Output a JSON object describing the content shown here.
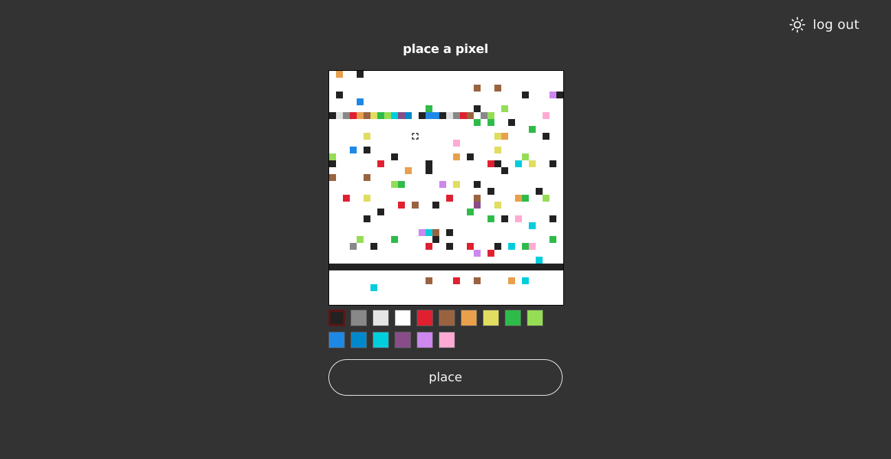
{
  "header": {
    "theme_toggle_icon": "sun-icon",
    "logout_label": "log out"
  },
  "title": "place a pixel",
  "canvas": {
    "background": "#ffffff",
    "grid_cells": 34,
    "cursor_cell": [
      12,
      9
    ],
    "pixels": [
      [
        1,
        0,
        "#e8a04c"
      ],
      [
        4,
        0,
        "#222222"
      ],
      [
        21,
        2,
        "#9a6340"
      ],
      [
        24,
        2,
        "#9a6340"
      ],
      [
        1,
        3,
        "#222222"
      ],
      [
        28,
        3,
        "#222222"
      ],
      [
        32,
        3,
        "#cc88ee"
      ],
      [
        33,
        3,
        "#222222"
      ],
      [
        4,
        4,
        "#1e88e5"
      ],
      [
        14,
        5,
        "#2ebb4a"
      ],
      [
        21,
        5,
        "#222222"
      ],
      [
        25,
        5,
        "#95dd55"
      ],
      [
        0,
        6,
        "#222222"
      ],
      [
        1,
        6,
        "#e0e0e0"
      ],
      [
        2,
        6,
        "#888888"
      ],
      [
        3,
        6,
        "#e02030"
      ],
      [
        4,
        6,
        "#e8a04c"
      ],
      [
        5,
        6,
        "#9a6340"
      ],
      [
        6,
        6,
        "#e0dd60"
      ],
      [
        7,
        6,
        "#2ebb4a"
      ],
      [
        8,
        6,
        "#95dd55"
      ],
      [
        9,
        6,
        "#00cedd"
      ],
      [
        10,
        6,
        "#884d88"
      ],
      [
        11,
        6,
        "#0088cc"
      ],
      [
        13,
        6,
        "#222222"
      ],
      [
        14,
        6,
        "#1e88e5"
      ],
      [
        15,
        6,
        "#1e88e5"
      ],
      [
        16,
        6,
        "#222222"
      ],
      [
        17,
        6,
        "#e0e0e0"
      ],
      [
        18,
        6,
        "#888888"
      ],
      [
        19,
        6,
        "#e02030"
      ],
      [
        20,
        6,
        "#9a6340"
      ],
      [
        22,
        6,
        "#888888"
      ],
      [
        23,
        6,
        "#95dd55"
      ],
      [
        31,
        6,
        "#ffaad4"
      ],
      [
        21,
        7,
        "#2ebb4a"
      ],
      [
        23,
        7,
        "#2ebb4a"
      ],
      [
        26,
        7,
        "#222222"
      ],
      [
        29,
        8,
        "#2ebb4a"
      ],
      [
        5,
        9,
        "#e0dd60"
      ],
      [
        24,
        9,
        "#e0dd60"
      ],
      [
        25,
        9,
        "#e8a04c"
      ],
      [
        31,
        9,
        "#222222"
      ],
      [
        18,
        10,
        "#ffaad4"
      ],
      [
        3,
        11,
        "#1e88e5"
      ],
      [
        5,
        11,
        "#222222"
      ],
      [
        24,
        11,
        "#e0dd60"
      ],
      [
        0,
        12,
        "#95dd55"
      ],
      [
        9,
        12,
        "#222222"
      ],
      [
        18,
        12,
        "#e8a04c"
      ],
      [
        20,
        12,
        "#222222"
      ],
      [
        28,
        12,
        "#95dd55"
      ],
      [
        0,
        13,
        "#222222"
      ],
      [
        7,
        13,
        "#e02030"
      ],
      [
        14,
        13,
        "#222222"
      ],
      [
        23,
        13,
        "#e02030"
      ],
      [
        24,
        13,
        "#222222"
      ],
      [
        27,
        13,
        "#00cedd"
      ],
      [
        29,
        13,
        "#e0dd60"
      ],
      [
        32,
        13,
        "#222222"
      ],
      [
        11,
        14,
        "#e8a04c"
      ],
      [
        14,
        14,
        "#222222"
      ],
      [
        25,
        14,
        "#222222"
      ],
      [
        0,
        15,
        "#9a6340"
      ],
      [
        5,
        15,
        "#9a6340"
      ],
      [
        9,
        16,
        "#95dd55"
      ],
      [
        10,
        16,
        "#2ebb4a"
      ],
      [
        16,
        16,
        "#cc88ee"
      ],
      [
        18,
        16,
        "#e0dd60"
      ],
      [
        21,
        16,
        "#222222"
      ],
      [
        23,
        17,
        "#222222"
      ],
      [
        30,
        17,
        "#222222"
      ],
      [
        2,
        18,
        "#e02030"
      ],
      [
        5,
        18,
        "#e0dd60"
      ],
      [
        17,
        18,
        "#e02030"
      ],
      [
        21,
        18,
        "#9a6340"
      ],
      [
        27,
        18,
        "#e8a04c"
      ],
      [
        28,
        18,
        "#2ebb4a"
      ],
      [
        31,
        18,
        "#95dd55"
      ],
      [
        10,
        19,
        "#e02030"
      ],
      [
        12,
        19,
        "#9a6340"
      ],
      [
        15,
        19,
        "#222222"
      ],
      [
        21,
        19,
        "#884d88"
      ],
      [
        24,
        19,
        "#e0dd60"
      ],
      [
        7,
        20,
        "#222222"
      ],
      [
        20,
        20,
        "#2ebb4a"
      ],
      [
        5,
        21,
        "#222222"
      ],
      [
        23,
        21,
        "#2ebb4a"
      ],
      [
        25,
        21,
        "#222222"
      ],
      [
        27,
        21,
        "#ffaad4"
      ],
      [
        32,
        21,
        "#222222"
      ],
      [
        29,
        22,
        "#00cedd"
      ],
      [
        13,
        23,
        "#cc88ee"
      ],
      [
        14,
        23,
        "#00cedd"
      ],
      [
        15,
        23,
        "#9a6340"
      ],
      [
        17,
        23,
        "#222222"
      ],
      [
        4,
        24,
        "#95dd55"
      ],
      [
        9,
        24,
        "#2ebb4a"
      ],
      [
        15,
        24,
        "#222222"
      ],
      [
        32,
        24,
        "#2ebb4a"
      ],
      [
        3,
        25,
        "#888888"
      ],
      [
        6,
        25,
        "#222222"
      ],
      [
        14,
        25,
        "#e02030"
      ],
      [
        17,
        25,
        "#222222"
      ],
      [
        20,
        25,
        "#e02030"
      ],
      [
        24,
        25,
        "#222222"
      ],
      [
        26,
        25,
        "#00cedd"
      ],
      [
        28,
        25,
        "#2ebb4a"
      ],
      [
        29,
        25,
        "#ffaad4"
      ],
      [
        21,
        26,
        "#cc88ee"
      ],
      [
        23,
        26,
        "#e02030"
      ],
      [
        30,
        27,
        "#00cedd"
      ],
      [
        14,
        30,
        "#9a6340"
      ],
      [
        18,
        30,
        "#e02030"
      ],
      [
        21,
        30,
        "#9a6340"
      ],
      [
        26,
        30,
        "#e8a04c"
      ],
      [
        28,
        30,
        "#00cedd"
      ],
      [
        6,
        31,
        "#00cedd"
      ]
    ],
    "filled_rows": [
      [
        28,
        "#222222"
      ]
    ]
  },
  "palette": {
    "selected_index": 0,
    "colors": [
      "#222222",
      "#888888",
      "#e4e4e4",
      "#ffffff",
      "#e02030",
      "#9a6340",
      "#e8a04c",
      "#e0dd60",
      "#2ebb4a",
      "#95dd55",
      "#1e88e5",
      "#0088cc",
      "#00cedd",
      "#884d88",
      "#cc88ee",
      "#ffaad4"
    ]
  },
  "place_button_label": "place"
}
